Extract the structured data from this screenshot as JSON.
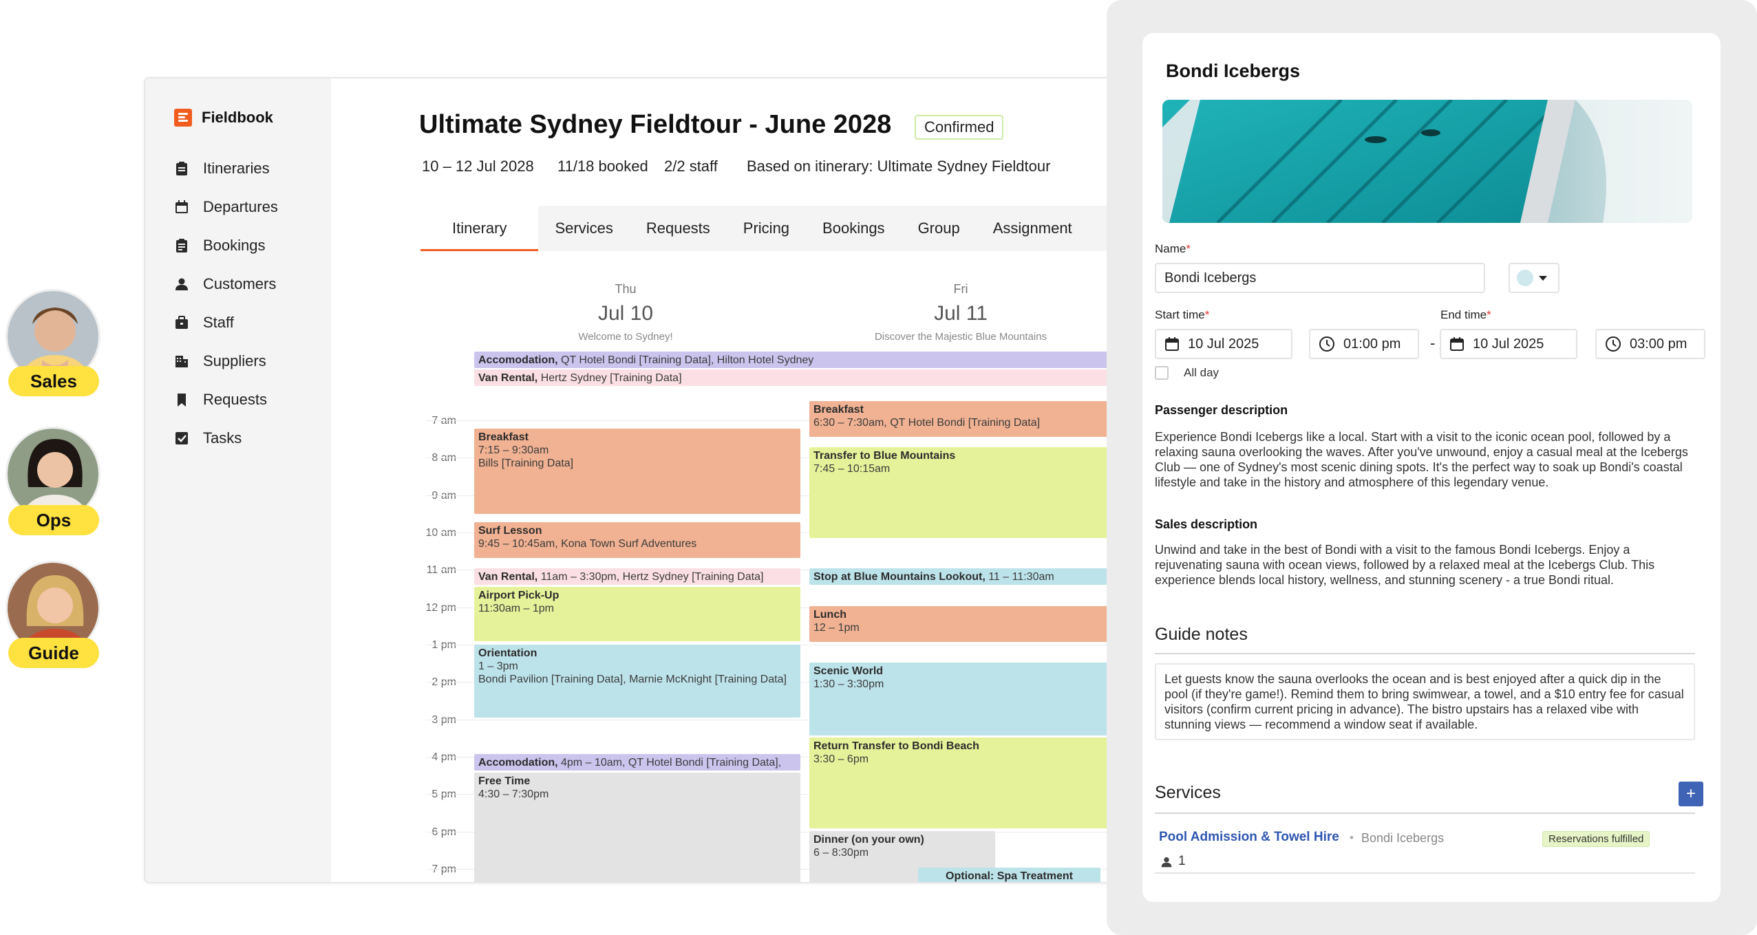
{
  "app": {
    "name": "Fieldbook"
  },
  "sidebar": {
    "items": [
      {
        "label": "Itineraries",
        "icon": "clipboard-icon"
      },
      {
        "label": "Departures",
        "icon": "calendar-icon"
      },
      {
        "label": "Bookings",
        "icon": "clipboard-list-icon"
      },
      {
        "label": "Customers",
        "icon": "person-icon"
      },
      {
        "label": "Staff",
        "icon": "briefcase-icon"
      },
      {
        "label": "Suppliers",
        "icon": "building-icon"
      },
      {
        "label": "Requests",
        "icon": "bookmark-icon"
      },
      {
        "label": "Tasks",
        "icon": "checkbox-icon"
      }
    ]
  },
  "departure": {
    "title": "Ultimate Sydney Fieldtour - June 2028",
    "status": "Confirmed",
    "dates": "10 – 12 Jul 2028",
    "booked": "11/18 booked",
    "staff": "2/2 staff",
    "based_on": "Based on itinerary: Ultimate Sydney Fieldtour"
  },
  "tabs": [
    "Itinerary",
    "Services",
    "Requests",
    "Pricing",
    "Bookings",
    "Group",
    "Assignment"
  ],
  "calendar": {
    "days": [
      {
        "dow": "Thu",
        "date": "Jul 10",
        "subtitle": "Welcome to Sydney!"
      },
      {
        "dow": "Fri",
        "date": "Jul 11",
        "subtitle": "Discover the Majestic Blue Mountains"
      }
    ],
    "hours": [
      "7 am",
      "8 am",
      "9 am",
      "10 am",
      "11 am",
      "12 pm",
      "1 pm",
      "2 pm",
      "3 pm",
      "4 pm",
      "5 pm",
      "6 pm",
      "7 pm"
    ],
    "allday": [
      {
        "title": "Accomodation,",
        "detail": " QT Hotel Bondi [Training Data], Hilton Hotel Sydney"
      },
      {
        "title": "Van Rental,",
        "detail": " Hertz Sydney [Training Data]"
      }
    ],
    "day1_events": [
      {
        "title": "Breakfast",
        "time": "7:15 – 9:30am",
        "detail": "Bills [Training Data]"
      },
      {
        "title": "Surf Lesson",
        "time": "9:45 – 10:45am,",
        "detail": " Kona Town Surf Adventures"
      },
      {
        "title": "Van Rental,",
        "time": " 11am – 3:30pm,",
        "detail": " Hertz Sydney [Training Data]"
      },
      {
        "title": "Airport Pick-Up",
        "time": "11:30am – 1pm",
        "detail": ""
      },
      {
        "title": "Orientation",
        "time": "1 – 3pm",
        "detail": "Bondi Pavilion [Training Data], Marnie McKnight [Training Data]"
      },
      {
        "title": "Accomodation,",
        "time": " 4pm – 10am,",
        "detail": " QT Hotel Bondi [Training Data],"
      },
      {
        "title": "Free Time",
        "time": "4:30 – 7:30pm",
        "detail": ""
      }
    ],
    "day2_events": [
      {
        "title": "Breakfast",
        "time": "6:30 – 7:30am,",
        "detail": " QT Hotel Bondi [Training Data]"
      },
      {
        "title": "Transfer to Blue Mountains",
        "time": "7:45 – 10:15am",
        "detail": ""
      },
      {
        "title": "Stop at Blue Mountains Lookout,",
        "time": " 11 – 11:30am",
        "detail": ""
      },
      {
        "title": "Lunch",
        "time": "12 – 1pm",
        "detail": ""
      },
      {
        "title": "Scenic World",
        "time": "1:30 – 3:30pm",
        "detail": ""
      },
      {
        "title": "Return Transfer to Bondi Beach",
        "time": "3:30 – 6pm",
        "detail": ""
      },
      {
        "title": "Dinner (on your own)",
        "time": "6 – 8:30pm",
        "detail": ""
      },
      {
        "title": "Optional: Spa Treatment",
        "time": "",
        "detail": ""
      }
    ]
  },
  "roles": [
    "Sales",
    "Ops",
    "Guide"
  ],
  "panel": {
    "title": "Bondi Icebergs",
    "name_label": "Name",
    "name_value": "Bondi Icebergs",
    "start_label": "Start time",
    "end_label": "End time",
    "start_date": "10 Jul 2025",
    "start_time": "01:00 pm",
    "end_date": "10 Jul 2025",
    "end_time": "03:00 pm",
    "separator": "-",
    "allday_label": "All day",
    "passenger_heading": "Passenger description",
    "passenger_text": "Experience Bondi Icebergs like a local. Start with a visit to the iconic ocean pool, followed by a relaxing sauna overlooking the waves. After you've unwound, enjoy a casual meal at the Icebergs Club — one of Sydney's most scenic dining spots. It's the perfect way to soak up Bondi's coastal lifestyle and take in the history and atmosphere of this legendary venue.",
    "sales_heading": "Sales description",
    "sales_text": "Unwind and take in the best of Bondi with a visit to the famous Bondi Icebergs. Enjoy a rejuvenating sauna with ocean views, followed by a relaxed meal at the Icebergs Club. This experience blends local history, wellness, and stunning scenery - a true Bondi ritual.",
    "guide_heading": "Guide notes",
    "guide_text": "Let guests know the sauna overlooks the ocean and is best enjoyed after a quick dip in the pool (if they're game!). Remind them to bring swimwear, a towel, and a $10 entry fee for casual visitors (confirm current pricing in advance). The bistro upstairs has a relaxed vibe with stunning views — recommend a window seat if available.",
    "services_heading": "Services",
    "add_label": "+",
    "service_name": "Pool Admission & Towel Hire",
    "service_supplier": "Bondi Icebergs",
    "service_dot": "•",
    "service_status": "Reservations fulfilled",
    "service_pax": "1"
  }
}
